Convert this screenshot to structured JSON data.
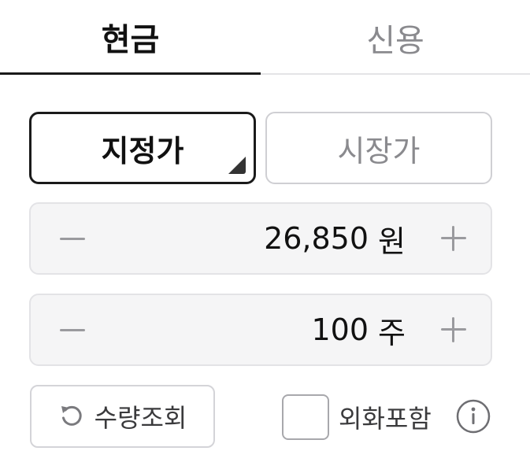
{
  "tabs": {
    "cash": "현금",
    "credit": "신용"
  },
  "order_type": {
    "limit": "지정가",
    "market": "시장가",
    "selected": "지정가"
  },
  "price": {
    "value": "26,850",
    "unit": "원"
  },
  "quantity": {
    "value": "100",
    "unit": "주"
  },
  "quantity_lookup": {
    "label": "수량조회",
    "icon": "refresh-icon"
  },
  "include_fx": {
    "label": "외화포함",
    "checked": false,
    "info_icon": "info-icon"
  },
  "colors": {
    "active_text": "#111111",
    "inactive_text": "#8a8a8e",
    "stepper_bg": "#f5f5f6",
    "border": "#d4d4d8"
  }
}
